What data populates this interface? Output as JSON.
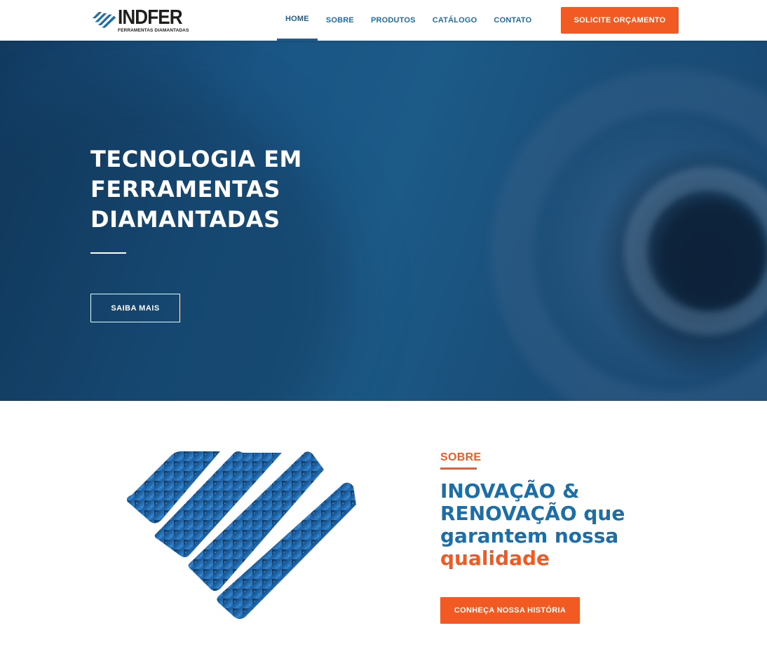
{
  "header": {
    "logo": {
      "name": "INDFER",
      "tagline": "FERRAMENTAS DIAMANTADAS"
    },
    "nav": [
      {
        "label": "HOME",
        "active": true
      },
      {
        "label": "SOBRE",
        "active": false
      },
      {
        "label": "PRODUTOS",
        "active": false
      },
      {
        "label": "CATÁLOGO",
        "active": false
      },
      {
        "label": "CONTATO",
        "active": false
      }
    ],
    "cta_label": "SOLICITE ORÇAMENTO"
  },
  "hero": {
    "title_lines": [
      "TECNOLOGIA EM",
      "FERRAMENTAS",
      "DIAMANTADAS"
    ],
    "button_label": "SAIBA MAIS"
  },
  "about": {
    "section_label": "SOBRE",
    "title_part1": "INOVAÇÃO &",
    "title_part2": "RENOVAÇÃO",
    "title_part3": " que garantem nossa ",
    "title_highlight": "qualidade",
    "button_label": "CONHEÇA NOSSA HISTÓRIA"
  },
  "colors": {
    "brand_blue": "#1b6ea8",
    "brand_orange": "#f15a22",
    "hero_overlay": "#1a5585"
  }
}
